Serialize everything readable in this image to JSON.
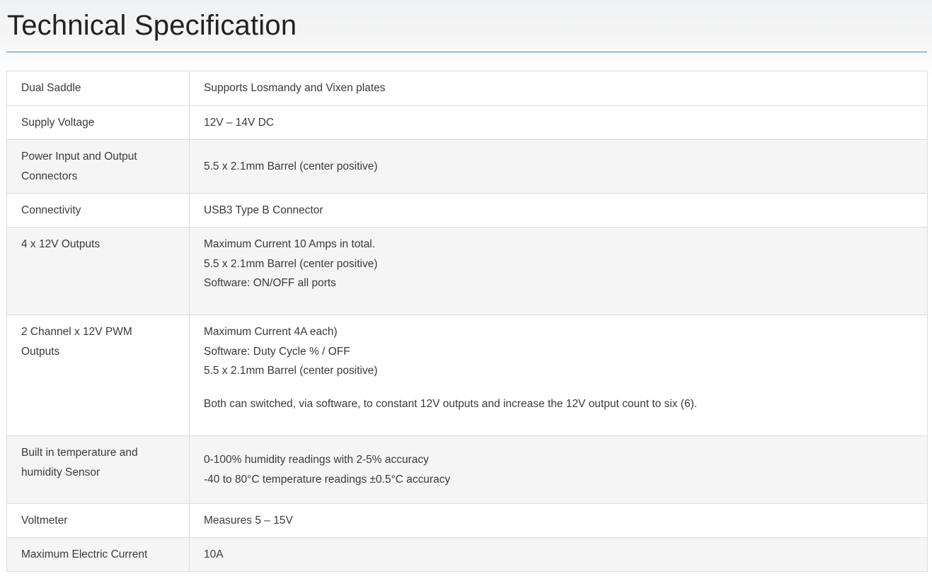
{
  "page": {
    "title": "Technical Specification"
  },
  "specs": [
    {
      "label": [
        "Dual Saddle"
      ],
      "value": [
        "Supports Losmandy and Vixen plates"
      ]
    },
    {
      "label": [
        "Supply Voltage"
      ],
      "value": [
        "12V – 14V DC"
      ]
    },
    {
      "label": [
        "Power Input and Output",
        "Connectors"
      ],
      "value": [
        "5.5 x 2.1mm Barrel (center positive)"
      ]
    },
    {
      "label": [
        "Connectivity"
      ],
      "value": [
        "USB3 Type B Connector"
      ]
    },
    {
      "label": [
        "4 x 12V Outputs"
      ],
      "value": [
        "Maximum Current 10 Amps in total.",
        "5.5 x 2.1mm Barrel (center positive)",
        "Software: ON/OFF all ports"
      ]
    },
    {
      "label": [
        "2 Channel x 12V PWM",
        "Outputs"
      ],
      "value": [
        "Maximum Current 4A each)",
        "Software: Duty Cycle % / OFF",
        "5.5 x 2.1mm Barrel (center positive)"
      ],
      "note": "Both can switched, via software, to constant 12V outputs and increase the 12V output count to six (6)."
    },
    {
      "label": [
        "Built in temperature and",
        "humidity Sensor"
      ],
      "value": [
        "0-100% humidity readings with 2-5% accuracy",
        "-40 to 80°C temperature readings ±0.5°C accuracy"
      ]
    },
    {
      "label": [
        "Voltmeter"
      ],
      "value": [
        "Measures 5 – 15V"
      ]
    },
    {
      "label": [
        "Maximum Electric Current"
      ],
      "value": [
        "10A"
      ]
    }
  ]
}
